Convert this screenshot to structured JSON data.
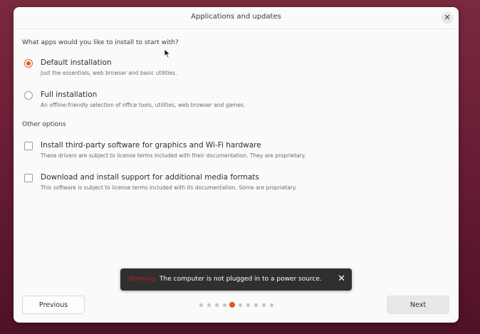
{
  "window": {
    "title": "Applications and updates",
    "close_icon": "close-icon"
  },
  "main": {
    "question": "What apps would you like to install to start with?",
    "install_options": [
      {
        "label": "Default installation",
        "description": "Just the essentials, web browser and basic utilities.",
        "selected": true
      },
      {
        "label": "Full installation",
        "description": "An offline-friendly selection of office tools, utilities, web browser and games.",
        "selected": false
      }
    ],
    "other_options_label": "Other options",
    "other_options": [
      {
        "label": "Install third-party software for graphics and Wi-Fi hardware",
        "description": "These drivers are subject to license terms included with their documentation. They are proprietary.",
        "checked": false
      },
      {
        "label": "Download and install support for additional media formats",
        "description": "This software is subject to license terms included with its documentation. Some are proprietary.",
        "checked": false
      }
    ]
  },
  "toast": {
    "warning_label": "Warning:",
    "message": "The computer is not plugged in to a power source.",
    "close_icon": "close-icon"
  },
  "footer": {
    "previous_label": "Previous",
    "next_label": "Next",
    "progress": {
      "total_steps": 10,
      "current_step": 5
    }
  },
  "colors": {
    "accent": "#e95420",
    "warning": "#c7162b"
  }
}
